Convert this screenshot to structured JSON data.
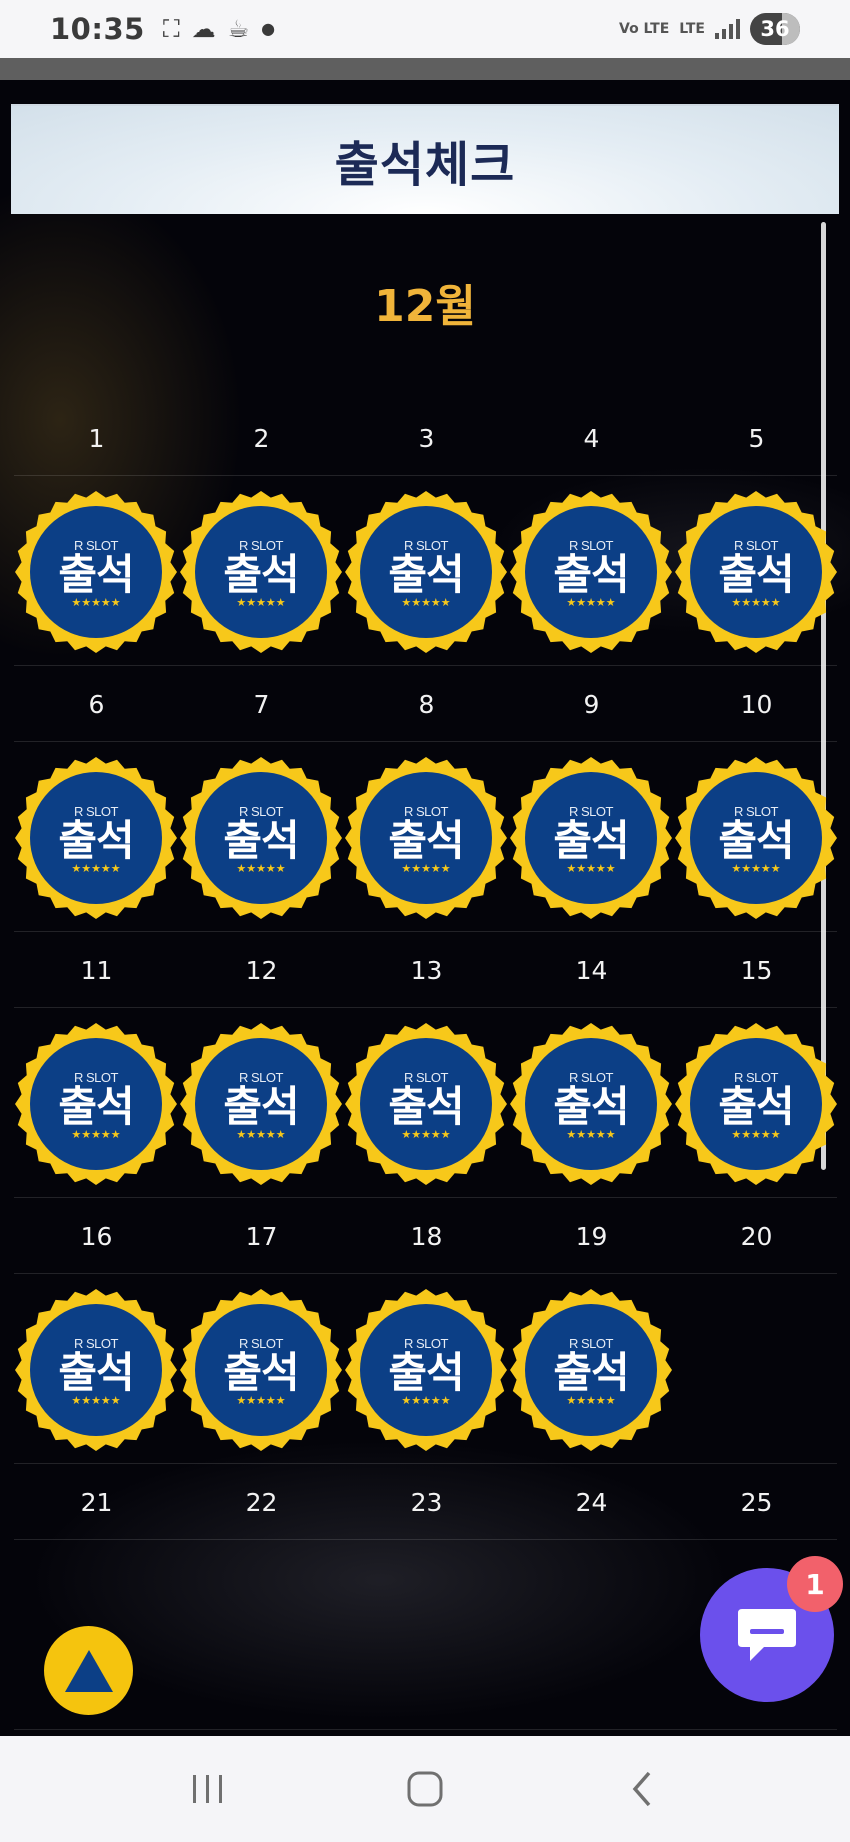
{
  "status_bar": {
    "time": "10:35",
    "volte": "Vo LTE",
    "lte": "LTE",
    "battery": "36"
  },
  "title": "출석체크",
  "month": "12월",
  "stamp": {
    "brand": "R SLOT",
    "label": "출석",
    "stars": "★★★★★"
  },
  "weeks": [
    {
      "days": [
        "1",
        "2",
        "3",
        "4",
        "5"
      ],
      "attended": [
        true,
        true,
        true,
        true,
        true
      ]
    },
    {
      "days": [
        "6",
        "7",
        "8",
        "9",
        "10"
      ],
      "attended": [
        true,
        true,
        true,
        true,
        true
      ]
    },
    {
      "days": [
        "11",
        "12",
        "13",
        "14",
        "15"
      ],
      "attended": [
        true,
        true,
        true,
        true,
        true
      ]
    },
    {
      "days": [
        "16",
        "17",
        "18",
        "19",
        "20"
      ],
      "attended": [
        true,
        true,
        true,
        true,
        false
      ]
    },
    {
      "days": [
        "21",
        "22",
        "23",
        "24",
        "25"
      ],
      "attended": [
        false,
        false,
        false,
        false,
        false
      ]
    }
  ],
  "chat": {
    "badge": "1",
    "icon": "chat-bubble-icon"
  },
  "scroll_top": {
    "icon": "triangle-up-icon"
  },
  "colors": {
    "month": "#f0b43a",
    "title": "#1c2a56",
    "stamp_ring": "#f7c81a",
    "stamp_fill": "#0c3f86",
    "chat": "#6b50ec",
    "badge": "#f2616b",
    "top_button": "#f5c40e"
  }
}
